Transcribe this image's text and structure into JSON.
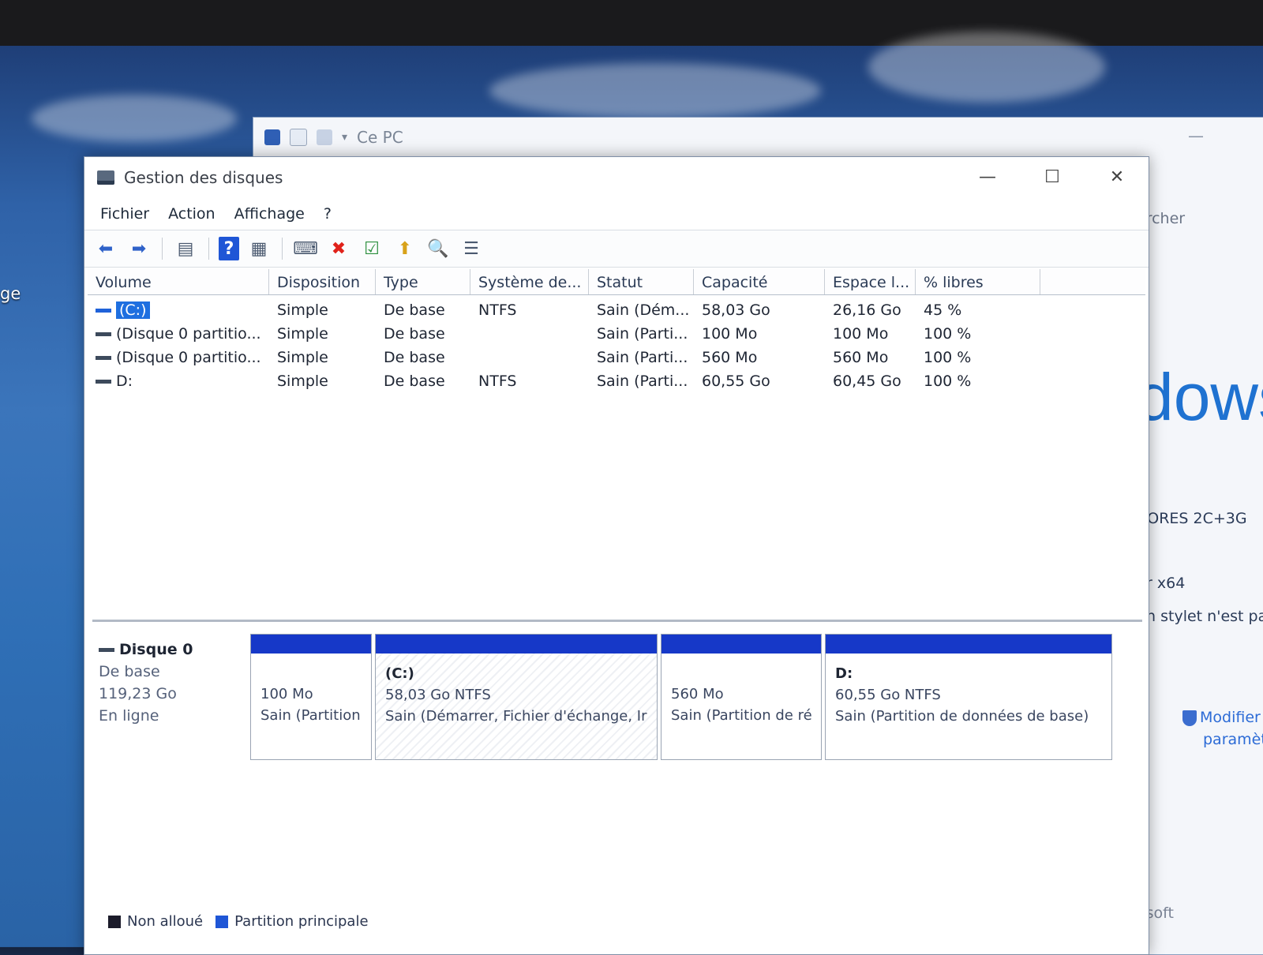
{
  "desktop": {
    "label": "ge"
  },
  "back_window": {
    "title": "Ce PC",
    "min": "—",
    "search_partial": "ercher",
    "brand_partial": "dows",
    "cores": "CORES 2C+3G",
    "arch": "ur x64",
    "pen": "un stylet n'est pas",
    "modify": "Modifier",
    "params": "paramèt",
    "footer": "osoft"
  },
  "window": {
    "title": "Gestion des disques",
    "controls": {
      "minimize": "—",
      "maximize": "☐",
      "close": "✕"
    }
  },
  "menu": [
    "Fichier",
    "Action",
    "Affichage",
    "?"
  ],
  "toolbar": {
    "back": "⬅",
    "forward": "➡",
    "console": "▤",
    "help": "?",
    "view": "▦",
    "connect": "⌨",
    "delete": "✖",
    "check": "☑",
    "up": "⬆",
    "search": "🔍",
    "props": "☰"
  },
  "table": {
    "headers": [
      "Volume",
      "Disposition",
      "Type",
      "Système de...",
      "Statut",
      "Capacité",
      "Espace l...",
      "% libres"
    ],
    "rows": [
      [
        "(C:)",
        "Simple",
        "De base",
        "NTFS",
        "Sain (Dém...",
        "58,03 Go",
        "26,16 Go",
        "45 %"
      ],
      [
        "(Disque 0 partitio...",
        "Simple",
        "De base",
        "",
        "Sain (Parti...",
        "100 Mo",
        "100 Mo",
        "100 %"
      ],
      [
        "(Disque 0 partitio...",
        "Simple",
        "De base",
        "",
        "Sain (Parti...",
        "560 Mo",
        "560 Mo",
        "100 %"
      ],
      [
        "D:",
        "Simple",
        "De base",
        "NTFS",
        "Sain (Parti...",
        "60,55 Go",
        "60,45 Go",
        "100 %"
      ]
    ]
  },
  "disk": {
    "name": "Disque 0",
    "type": "De base",
    "size": "119,23 Go",
    "status": "En ligne"
  },
  "partitions": [
    {
      "title": "",
      "size": "100 Mo",
      "status": "Sain (Partition"
    },
    {
      "title": "(C:)",
      "size": "58,03 Go NTFS",
      "status": "Sain (Démarrer, Fichier d'échange, Ir"
    },
    {
      "title": "",
      "size": "560 Mo",
      "status": "Sain (Partition de ré"
    },
    {
      "title": "D:",
      "size": "60,55 Go NTFS",
      "status": "Sain (Partition de données de base)"
    }
  ],
  "legend": {
    "unallocated": "Non alloué",
    "primary": "Partition principale"
  },
  "colors": {
    "partition_bar": "#1638c8",
    "selection": "#1e6fe0",
    "unallocated": "#1b1b2a",
    "primary": "#1f56d6",
    "delete": "#e0221a"
  }
}
